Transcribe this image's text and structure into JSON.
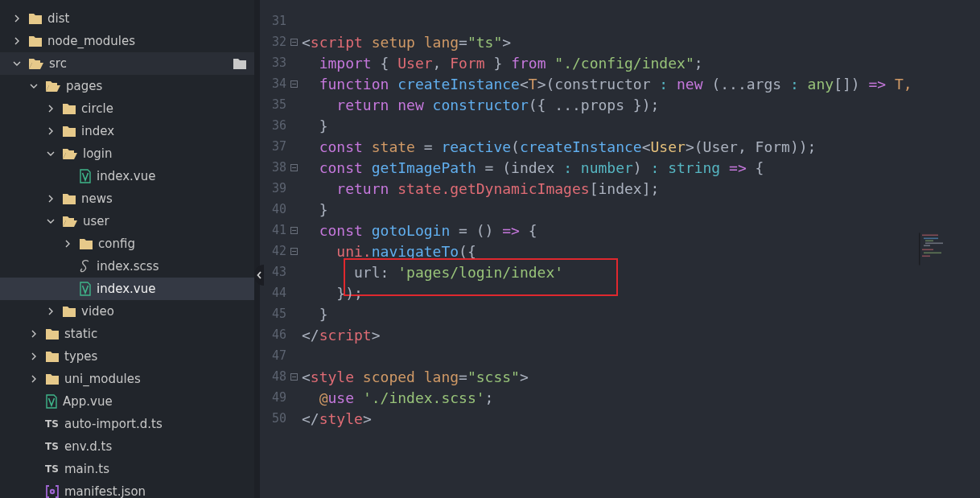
{
  "sidebar": {
    "items": [
      {
        "label": "dist",
        "kind": "folder",
        "expanded": false,
        "selected": false,
        "hovered": false
      },
      {
        "label": "node_modules",
        "kind": "folder",
        "expanded": false,
        "selected": false,
        "hovered": false
      },
      {
        "label": "src",
        "kind": "folder",
        "expanded": true,
        "selected": false,
        "hovered": true,
        "children": [
          {
            "label": "pages",
            "kind": "folder",
            "expanded": true,
            "selected": false,
            "hovered": false,
            "children": [
              {
                "label": "circle",
                "kind": "folder",
                "expanded": false,
                "selected": false,
                "hovered": false
              },
              {
                "label": "index",
                "kind": "folder",
                "expanded": false,
                "selected": false,
                "hovered": false
              },
              {
                "label": "login",
                "kind": "folder",
                "expanded": true,
                "selected": false,
                "hovered": false,
                "children": [
                  {
                    "label": "index.vue",
                    "kind": "vue",
                    "selected": false,
                    "hovered": false
                  }
                ]
              },
              {
                "label": "news",
                "kind": "folder",
                "expanded": false,
                "selected": false,
                "hovered": false
              },
              {
                "label": "user",
                "kind": "folder",
                "expanded": true,
                "selected": false,
                "hovered": false,
                "children": [
                  {
                    "label": "config",
                    "kind": "folder",
                    "expanded": false,
                    "selected": false,
                    "hovered": false
                  },
                  {
                    "label": "index.scss",
                    "kind": "scss",
                    "selected": false,
                    "hovered": false
                  },
                  {
                    "label": "index.vue",
                    "kind": "vue",
                    "selected": true,
                    "hovered": false
                  }
                ]
              },
              {
                "label": "video",
                "kind": "folder",
                "expanded": false,
                "selected": false,
                "hovered": false
              }
            ]
          },
          {
            "label": "static",
            "kind": "folder",
            "expanded": false,
            "selected": false,
            "hovered": false
          },
          {
            "label": "types",
            "kind": "folder",
            "expanded": false,
            "selected": false,
            "hovered": false
          },
          {
            "label": "uni_modules",
            "kind": "folder",
            "expanded": false,
            "selected": false,
            "hovered": false
          },
          {
            "label": "App.vue",
            "kind": "vue",
            "selected": false,
            "hovered": false
          },
          {
            "label": "auto-import.d.ts",
            "kind": "ts",
            "icon_text": "TS",
            "selected": false,
            "hovered": false
          },
          {
            "label": "env.d.ts",
            "kind": "ts",
            "icon_text": "TS",
            "selected": false,
            "hovered": false
          },
          {
            "label": "main.ts",
            "kind": "ts",
            "icon_text": "TS",
            "selected": false,
            "hovered": false
          },
          {
            "label": "manifest.json",
            "kind": "json",
            "selected": false,
            "hovered": false
          }
        ]
      }
    ]
  },
  "editor": {
    "lines": [
      {
        "number": "31",
        "foldable": false,
        "highlighted": false
      },
      {
        "number": "32",
        "foldable": true,
        "highlighted": false,
        "tokens": [
          {
            "text": "<",
            "color": "#abb2bf"
          },
          {
            "text": "script",
            "color": "#e06c75"
          },
          {
            "text": " setup lang",
            "color": "#d19a66"
          },
          {
            "text": "=",
            "color": "#abb2bf"
          },
          {
            "text": "\"ts\"",
            "color": "#98c379"
          },
          {
            "text": ">",
            "color": "#abb2bf"
          }
        ]
      },
      {
        "number": "33",
        "foldable": false,
        "highlighted": false,
        "tokens": [
          {
            "text": "  import",
            "color": "#c678dd"
          },
          {
            "text": " { ",
            "color": "#abb2bf"
          },
          {
            "text": "User",
            "color": "#e06c75"
          },
          {
            "text": ", ",
            "color": "#abb2bf"
          },
          {
            "text": "Form",
            "color": "#e06c75"
          },
          {
            "text": " } ",
            "color": "#abb2bf"
          },
          {
            "text": "from ",
            "color": "#c678dd"
          },
          {
            "text": "\"./config/index\"",
            "color": "#98c379"
          },
          {
            "text": ";",
            "color": "#abb2bf"
          }
        ]
      },
      {
        "number": "34",
        "foldable": true,
        "highlighted": false,
        "tokens": [
          {
            "text": "  function ",
            "color": "#c678dd"
          },
          {
            "text": "createInstance",
            "color": "#61afef"
          },
          {
            "text": "<",
            "color": "#abb2bf"
          },
          {
            "text": "T",
            "color": "#d19a66"
          },
          {
            "text": ">(constructor ",
            "color": "#abb2bf"
          },
          {
            "text": ": ",
            "color": "#56b6c2"
          },
          {
            "text": "new",
            "color": "#c678dd"
          },
          {
            "text": " (...args ",
            "color": "#abb2bf"
          },
          {
            "text": ": ",
            "color": "#56b6c2"
          },
          {
            "text": "any",
            "color": "#98c379"
          },
          {
            "text": "[]) ",
            "color": "#abb2bf"
          },
          {
            "text": "=> ",
            "color": "#c678dd"
          },
          {
            "text": "T,",
            "color": "#d19a66"
          }
        ]
      },
      {
        "number": "35",
        "foldable": false,
        "highlighted": false,
        "tokens": [
          {
            "text": "    return new ",
            "color": "#c678dd"
          },
          {
            "text": "constructor",
            "color": "#61afef"
          },
          {
            "text": "({ ...props });",
            "color": "#abb2bf"
          }
        ]
      },
      {
        "number": "36",
        "foldable": false,
        "highlighted": false,
        "tokens": [
          {
            "text": "  }",
            "color": "#abb2bf"
          }
        ]
      },
      {
        "number": "37",
        "foldable": false,
        "highlighted": false,
        "tokens": [
          {
            "text": "  const ",
            "color": "#c678dd"
          },
          {
            "text": "state",
            "color": "#d19a66"
          },
          {
            "text": " = ",
            "color": "#abb2bf"
          },
          {
            "text": "reactive",
            "color": "#61afef"
          },
          {
            "text": "(",
            "color": "#abb2bf"
          },
          {
            "text": "createInstance",
            "color": "#61afef"
          },
          {
            "text": "<",
            "color": "#abb2bf"
          },
          {
            "text": "User",
            "color": "#e5c07b"
          },
          {
            "text": ">(User, Form));",
            "color": "#abb2bf"
          }
        ]
      },
      {
        "number": "38",
        "foldable": true,
        "highlighted": false,
        "tokens": [
          {
            "text": "  const ",
            "color": "#c678dd"
          },
          {
            "text": "getImagePath",
            "color": "#61afef"
          },
          {
            "text": " = (index ",
            "color": "#abb2bf"
          },
          {
            "text": ": number",
            "color": "#56b6c2"
          },
          {
            "text": ") ",
            "color": "#abb2bf"
          },
          {
            "text": ": string ",
            "color": "#56b6c2"
          },
          {
            "text": "=>",
            "color": "#c678dd"
          },
          {
            "text": " {",
            "color": "#abb2bf"
          }
        ]
      },
      {
        "number": "39",
        "foldable": false,
        "highlighted": false,
        "tokens": [
          {
            "text": "    return ",
            "color": "#c678dd"
          },
          {
            "text": "state.getDynamicImages",
            "color": "#e06c75"
          },
          {
            "text": "[index];",
            "color": "#abb2bf"
          }
        ]
      },
      {
        "number": "40",
        "foldable": false,
        "highlighted": false,
        "tokens": [
          {
            "text": "  }",
            "color": "#abb2bf"
          }
        ]
      },
      {
        "number": "41",
        "foldable": true,
        "highlighted": false,
        "tokens": [
          {
            "text": "  const ",
            "color": "#c678dd"
          },
          {
            "text": "gotoLogin",
            "color": "#61afef"
          },
          {
            "text": " = () ",
            "color": "#abb2bf"
          },
          {
            "text": "=>",
            "color": "#c678dd"
          },
          {
            "text": " {",
            "color": "#abb2bf"
          }
        ]
      },
      {
        "number": "42",
        "foldable": true,
        "highlighted": false,
        "tokens": [
          {
            "text": "    uni.",
            "color": "#e06c75"
          },
          {
            "text": "navigateTo",
            "color": "#61afef"
          },
          {
            "text": "({",
            "color": "#abb2bf"
          }
        ]
      },
      {
        "number": "43",
        "foldable": false,
        "highlighted": true,
        "tokens": [
          {
            "text": "      url: ",
            "color": "#abb2bf"
          },
          {
            "text": "'pages/login/index'",
            "color": "#98c379"
          }
        ]
      },
      {
        "number": "44",
        "foldable": false,
        "highlighted": false,
        "tokens": [
          {
            "text": "    });",
            "color": "#abb2bf"
          }
        ]
      },
      {
        "number": "45",
        "foldable": false,
        "highlighted": false,
        "tokens": [
          {
            "text": "  }",
            "color": "#abb2bf"
          }
        ]
      },
      {
        "number": "46",
        "foldable": false,
        "highlighted": false,
        "tokens": [
          {
            "text": "</",
            "color": "#abb2bf"
          },
          {
            "text": "script",
            "color": "#e06c75"
          },
          {
            "text": ">",
            "color": "#abb2bf"
          }
        ]
      },
      {
        "number": "47",
        "foldable": false,
        "highlighted": false
      },
      {
        "number": "48",
        "foldable": true,
        "highlighted": false,
        "tokens": [
          {
            "text": "<",
            "color": "#abb2bf"
          },
          {
            "text": "style",
            "color": "#e06c75"
          },
          {
            "text": " scoped lang",
            "color": "#d19a66"
          },
          {
            "text": "=",
            "color": "#abb2bf"
          },
          {
            "text": "\"scss\"",
            "color": "#98c379"
          },
          {
            "text": ">",
            "color": "#abb2bf"
          }
        ]
      },
      {
        "number": "49",
        "foldable": false,
        "highlighted": false,
        "tokens": [
          {
            "text": "  @",
            "color": "#d19a66"
          },
          {
            "text": "use ",
            "color": "#c678dd"
          },
          {
            "text": "'./index.scss'",
            "color": "#98c379"
          },
          {
            "text": ";",
            "color": "#abb2bf"
          }
        ]
      },
      {
        "number": "50",
        "foldable": false,
        "highlighted": false,
        "tokens": [
          {
            "text": "</",
            "color": "#abb2bf"
          },
          {
            "text": "style",
            "color": "#e06c75"
          },
          {
            "text": ">",
            "color": "#abb2bf"
          }
        ]
      }
    ]
  }
}
